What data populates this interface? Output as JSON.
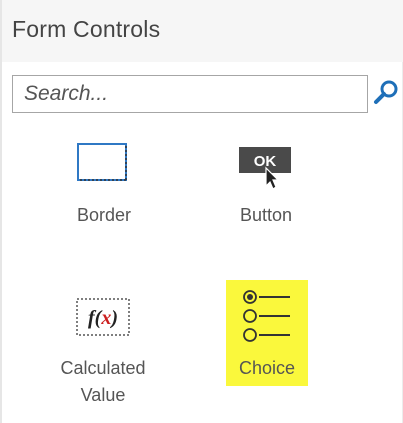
{
  "panel": {
    "title": "Form Controls"
  },
  "search": {
    "placeholder": "Search...",
    "value": ""
  },
  "controls": [
    {
      "label": "Border",
      "icon": "border-icon",
      "selected": false
    },
    {
      "label": "Button",
      "icon": "ok-button-icon",
      "icon_text": "OK",
      "selected": false
    },
    {
      "label_lines": [
        "Calculated",
        "Value"
      ],
      "icon": "function-icon",
      "icon_text": "f(x)",
      "selected": false
    },
    {
      "label": "Choice",
      "icon": "choice-list-icon",
      "selected": true
    }
  ],
  "colors": {
    "header_bg": "#f6f6f6",
    "text": "#555555",
    "search_icon": "#1e6fb8",
    "selected_highlight": "#faf83c",
    "function_x": "#cc1f1f"
  }
}
